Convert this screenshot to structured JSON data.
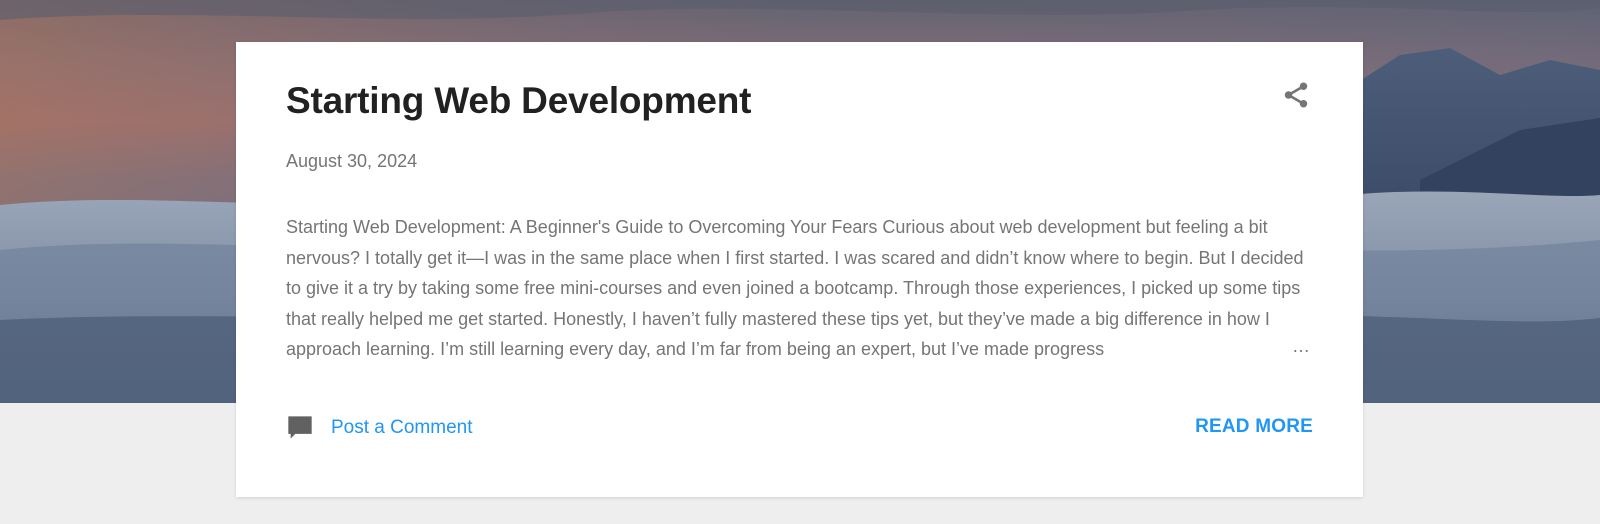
{
  "post": {
    "title": "Starting Web Development",
    "date": "August 30, 2024",
    "snippet": "Starting Web Development: A Beginner's Guide to Overcoming Your Fears Curious about web development but feeling a bit nervous? I totally get it—I was in the same place when I first started. I was scared and didn’t know where to begin. But I decided to give it a try by taking some free mini-courses and even joined a bootcamp. Through those experiences, I picked up some tips that really helped me get started. Honestly, I haven’t fully mastered these tips yet, but they’ve made a big difference in how I approach learning. I’m still learning every day, and I’m far from being an expert, but I’ve made progress",
    "ellipsis": "…",
    "comment_label": "Post a Comment",
    "read_more_label": "READ MORE"
  },
  "icons": {
    "share": "share-icon",
    "comment": "comment-icon"
  },
  "colors": {
    "title": "#212121",
    "meta_text": "#757575",
    "link": "#2196f3",
    "page_background": "#eeeeee",
    "card_background": "#ffffff"
  }
}
